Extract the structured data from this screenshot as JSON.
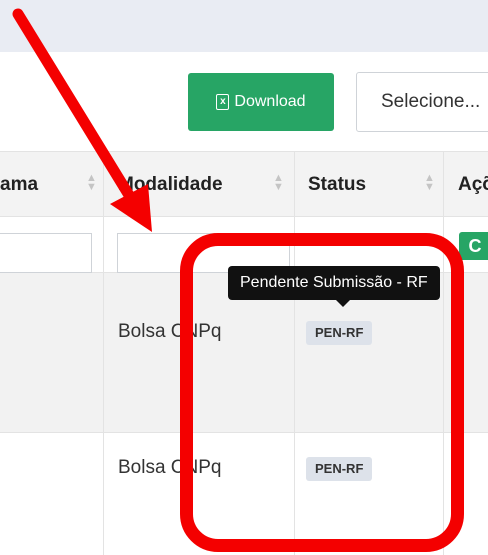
{
  "toolbar": {
    "download_label": "Download",
    "download_icon": "excel-file-icon",
    "download_color": "#27a565",
    "select_value": "Selecione..."
  },
  "table": {
    "columns": [
      {
        "key": "programa",
        "label": "ama"
      },
      {
        "key": "modalidade",
        "label": "Modalidade"
      },
      {
        "key": "status",
        "label": "Status"
      },
      {
        "key": "acoes",
        "label": "Açõ"
      }
    ],
    "rows": [
      {
        "modalidade": "Bolsa CNPq",
        "status": "PEN-RF"
      },
      {
        "modalidade": "Bolsa CNPq",
        "status": "PEN-RF"
      }
    ],
    "action_button_label": "C"
  },
  "tooltip": {
    "text": "Pendente Submissão - RF"
  },
  "annotation": {
    "color": "#f40000"
  }
}
